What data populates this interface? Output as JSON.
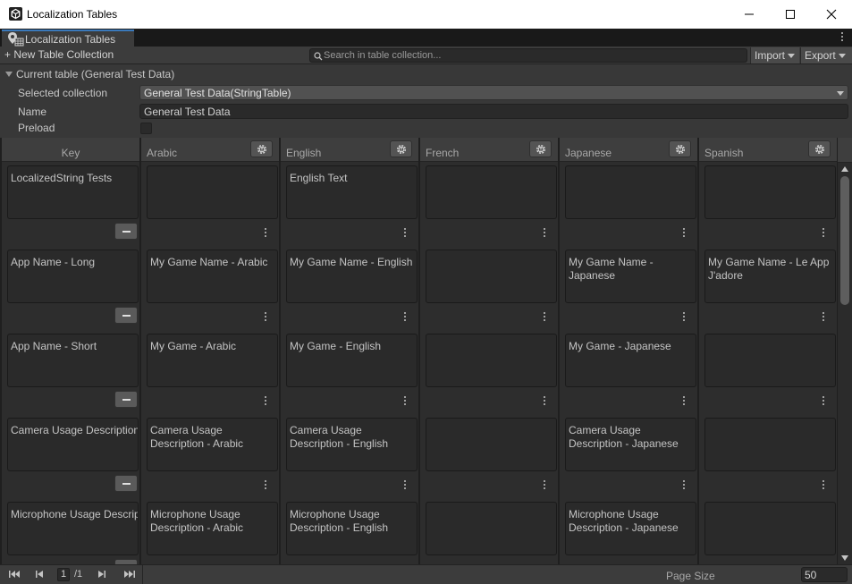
{
  "window": {
    "title": "Localization Tables"
  },
  "tab": {
    "label": "Localization Tables"
  },
  "toolbar": {
    "new_collection_label": "+ New Table Collection",
    "search_placeholder": "Search in table collection...",
    "import_label": "Import",
    "export_label": "Export"
  },
  "inspector": {
    "current_table_label": "Current table (General Test Data)",
    "selected_collection_label": "Selected collection",
    "selected_collection_value": "General Test Data(StringTable)",
    "name_label": "Name",
    "name_value": "General Test Data",
    "preload_label": "Preload",
    "preload_checked": false
  },
  "grid": {
    "columns": [
      {
        "header": "Key"
      },
      {
        "header": "Arabic"
      },
      {
        "header": "English"
      },
      {
        "header": "French"
      },
      {
        "header": "Japanese"
      },
      {
        "header": "Spanish"
      }
    ],
    "rows": [
      {
        "key": "LocalizedString Tests",
        "values": [
          "",
          "English Text",
          "",
          "",
          ""
        ]
      },
      {
        "key": "App Name - Long",
        "values": [
          "My Game Name - Arabic",
          "My Game Name - English",
          "",
          "My Game Name - Japanese",
          "My Game Name - Le App J'adore"
        ]
      },
      {
        "key": "App Name - Short",
        "values": [
          "My Game - Arabic",
          "My Game - English",
          "",
          "My Game  - Japanese",
          ""
        ]
      },
      {
        "key": "Camera Usage Description",
        "values": [
          "Camera Usage Description - Arabic",
          "Camera Usage Description - English",
          "",
          "Camera Usage Description - Japanese",
          ""
        ]
      },
      {
        "key": "Microphone Usage Description",
        "values": [
          "Microphone Usage Description - Arabic",
          "Microphone Usage Description - English",
          "",
          "Microphone Usage Description - Japanese",
          ""
        ]
      }
    ]
  },
  "footer": {
    "current_page": "1",
    "total_pages": "/1",
    "page_size_label": "Page Size",
    "page_size_value": "50"
  },
  "colors": {
    "background": "#282828",
    "accent": "#3a79bb"
  }
}
